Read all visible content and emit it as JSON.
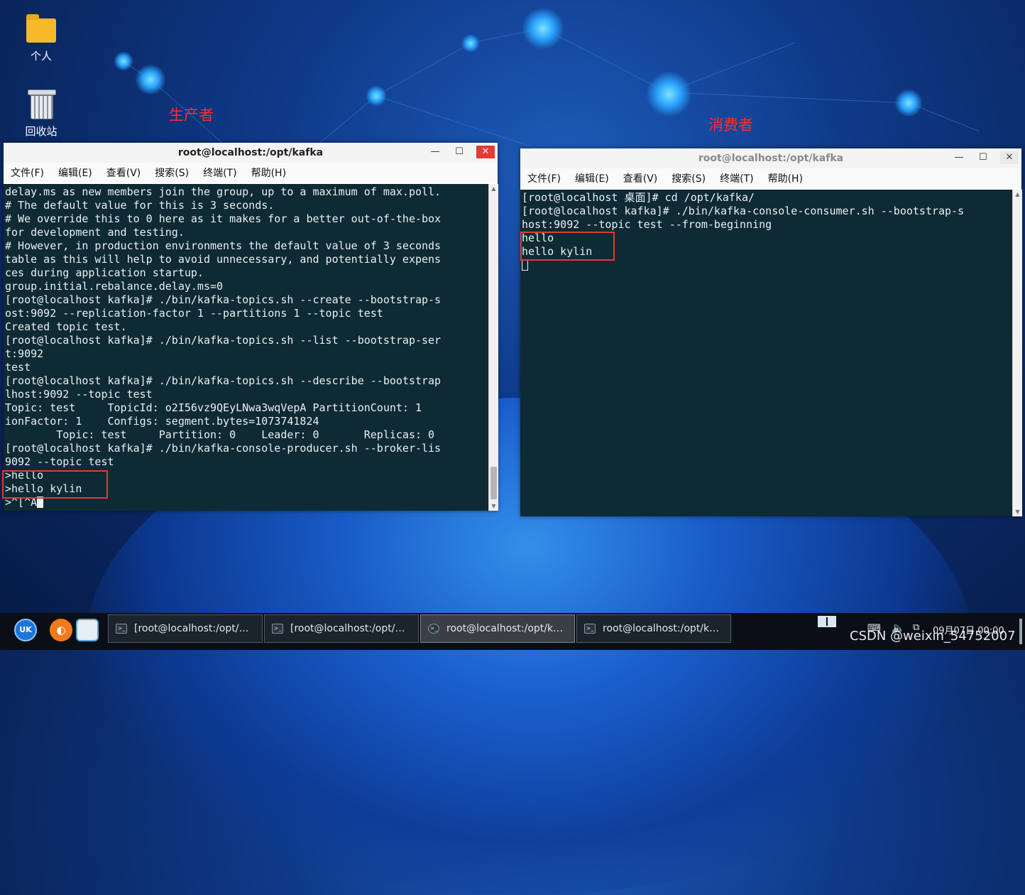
{
  "desktop": {
    "icons": [
      {
        "label": "个人"
      },
      {
        "label": "回收站"
      }
    ],
    "annotations": {
      "producer": "生产者",
      "consumer": "消费者"
    }
  },
  "windows": {
    "producer": {
      "title": "root@localhost:/opt/kafka",
      "menu": [
        "文件(F)",
        "编辑(E)",
        "查看(V)",
        "搜索(S)",
        "终端(T)",
        "帮助(H)"
      ],
      "lines": [
        "delay.ms as new members join the group, up to a maximum of max.poll.",
        "# The default value for this is 3 seconds.",
        "# We override this to 0 here as it makes for a better out-of-the-box",
        "for development and testing.",
        "# However, in production environments the default value of 3 seconds",
        "table as this will help to avoid unnecessary, and potentially expens",
        "ces during application startup.",
        "group.initial.rebalance.delay.ms=0",
        "[root@localhost kafka]# ./bin/kafka-topics.sh --create --bootstrap-s",
        "ost:9092 --replication-factor 1 --partitions 1 --topic test",
        "Created topic test.",
        "[root@localhost kafka]# ./bin/kafka-topics.sh --list --bootstrap-ser",
        "t:9092",
        "test",
        "[root@localhost kafka]# ./bin/kafka-topics.sh --describe --bootstrap",
        "lhost:9092 --topic test",
        "Topic: test     TopicId: o2I56vz9QEyLNwa3wqVepA PartitionCount: 1",
        "ionFactor: 1    Configs: segment.bytes=1073741824",
        "        Topic: test     Partition: 0    Leader: 0       Replicas: 0",
        "[root@localhost kafka]# ./bin/kafka-console-producer.sh --broker-lis",
        "9092 --topic test",
        ">hello",
        ">hello kylin"
      ],
      "prompt": ">^[^A"
    },
    "consumer": {
      "title": "root@localhost:/opt/kafka",
      "menu": [
        "文件(F)",
        "编辑(E)",
        "查看(V)",
        "搜索(S)",
        "终端(T)",
        "帮助(H)"
      ],
      "lines": [
        "[root@localhost 桌面]# cd /opt/kafka/",
        "[root@localhost kafka]# ./bin/kafka-console-consumer.sh --bootstrap-s",
        "host:9092 --topic test --from-beginning",
        "hello",
        "hello kylin"
      ]
    }
  },
  "taskbar": {
    "tasks": [
      {
        "label": "[root@localhost:/opt/…"
      },
      {
        "label": "[root@localhost:/opt/…"
      },
      {
        "label": "root@localhost:/opt/k…"
      },
      {
        "label": "root@localhost:/opt/k…"
      }
    ],
    "clock": "09月07日 00:00",
    "watermark": "CSDN @weixin_54752007"
  },
  "colors": {
    "terminal_bg": "#0e2a34",
    "close_red": "#e53935",
    "annotation_red": "#ff2d2d"
  }
}
